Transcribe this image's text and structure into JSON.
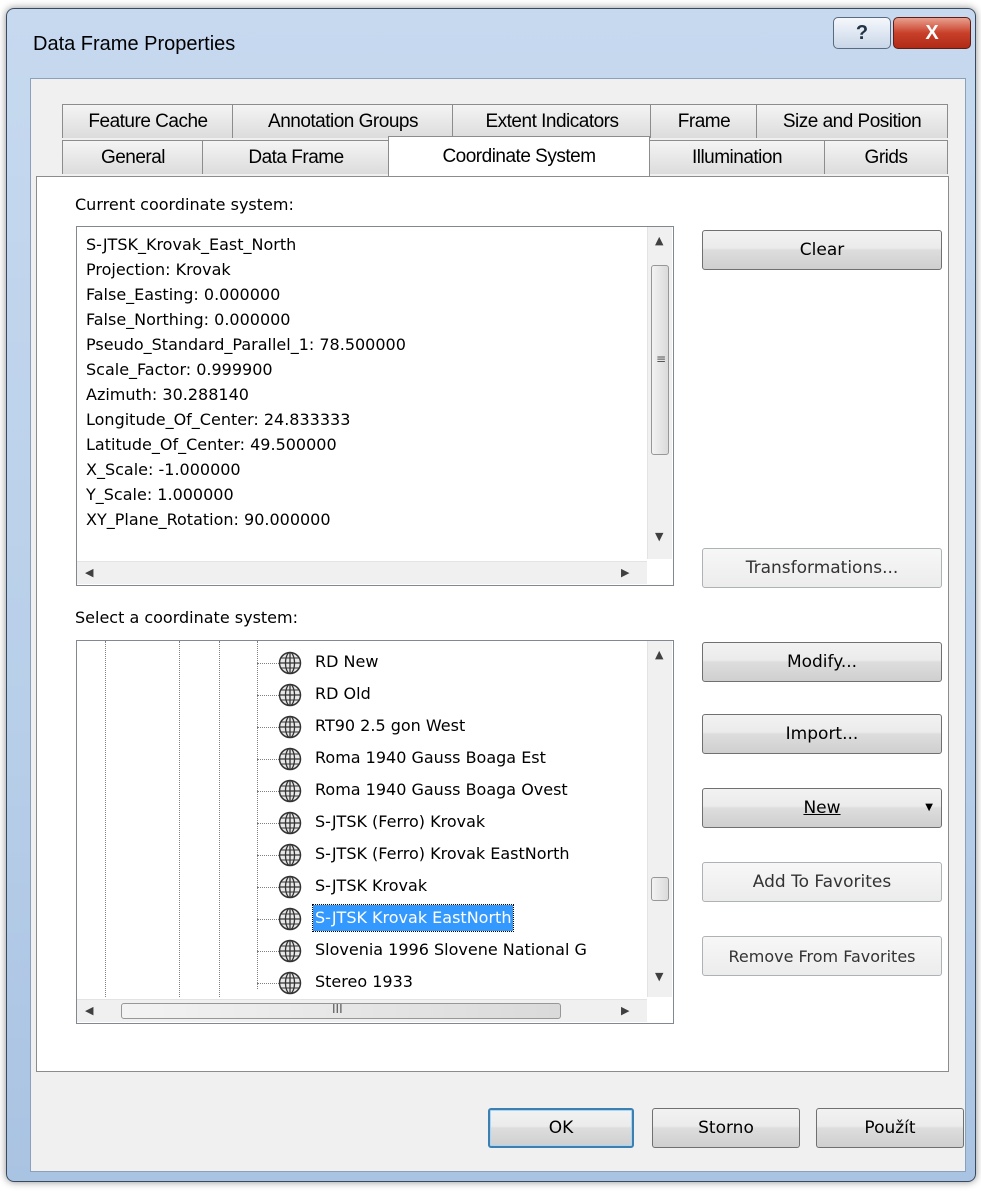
{
  "window": {
    "title": "Data Frame Properties",
    "help_label": "?",
    "close_label": "X"
  },
  "tabs": {
    "row1": [
      "Feature Cache",
      "Annotation Groups",
      "Extent Indicators",
      "Frame",
      "Size and Position"
    ],
    "row2": [
      "General",
      "Data Frame",
      "Coordinate System",
      "Illumination",
      "Grids"
    ],
    "active": "Coordinate System"
  },
  "current": {
    "label": "Current coordinate system:",
    "lines": [
      "S-JTSK_Krovak_East_North",
      "Projection: Krovak",
      "False_Easting: 0.000000",
      "False_Northing: 0.000000",
      "Pseudo_Standard_Parallel_1: 78.500000",
      "Scale_Factor: 0.999900",
      "Azimuth: 30.288140",
      "Longitude_Of_Center: 24.833333",
      "Latitude_Of_Center: 49.500000",
      "X_Scale: -1.000000",
      "Y_Scale: 1.000000",
      "XY_Plane_Rotation: 90.000000"
    ]
  },
  "select": {
    "label": "Select a coordinate system:",
    "items": [
      "RD New",
      "RD Old",
      "RT90 2.5 gon West",
      "Roma 1940 Gauss Boaga Est",
      "Roma 1940 Gauss Boaga Ovest",
      "S-JTSK (Ferro) Krovak",
      "S-JTSK (Ferro) Krovak EastNorth",
      "S-JTSK Krovak",
      "S-JTSK Krovak EastNorth",
      "Slovenia 1996 Slovene National G",
      "Stereo 1933"
    ],
    "selected_index": 8
  },
  "buttons": {
    "clear": "Clear",
    "transformations": "Transformations...",
    "modify": "Modify...",
    "import": "Import...",
    "new": "New",
    "add_favorites": "Add To Favorites",
    "remove_favorites": "Remove From Favorites",
    "ok": "OK",
    "cancel": "Storno",
    "apply": "Použít"
  }
}
